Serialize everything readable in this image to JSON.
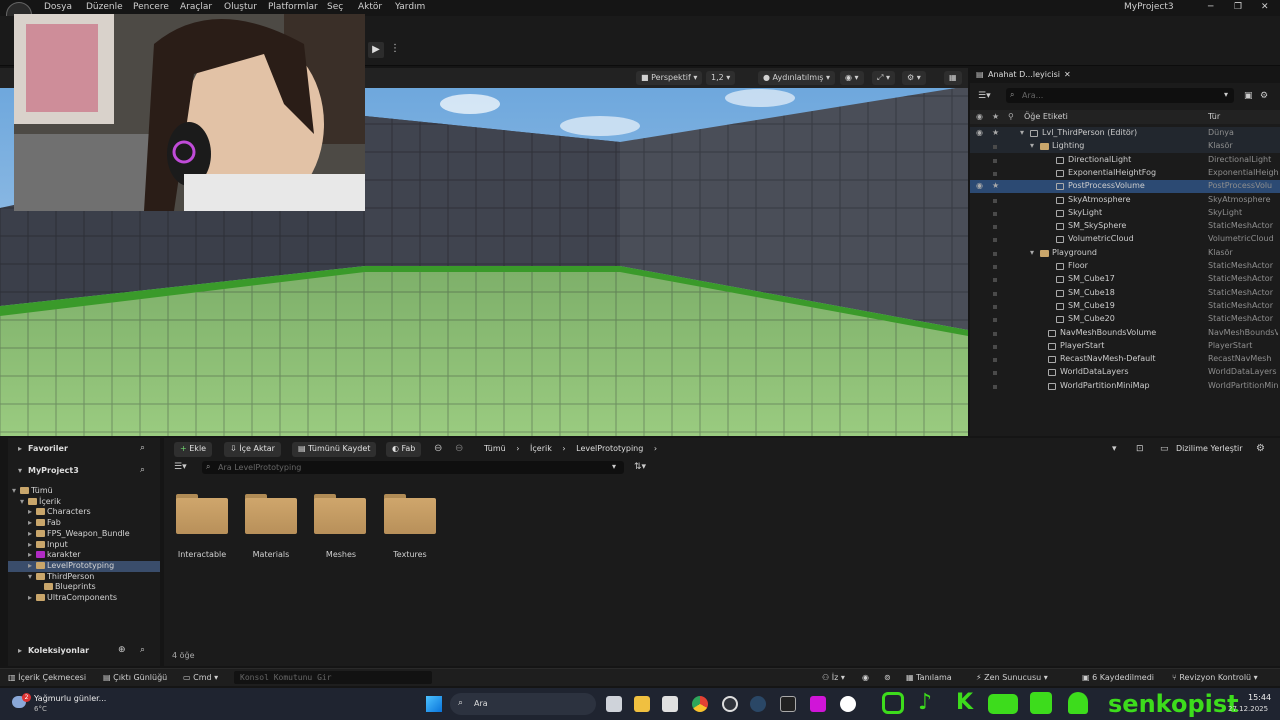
{
  "window": {
    "title": "MyProject3"
  },
  "menu": [
    "Dosya",
    "Düzenle",
    "Pencere",
    "Araçlar",
    "Oluştur",
    "Platformlar",
    "Seç",
    "Aktör",
    "Yardım"
  ],
  "viewport": {
    "buttons": {
      "perspective": "Perspektif",
      "fov": "1,2",
      "lit": "Aydınlatılmış"
    }
  },
  "outliner": {
    "tab": "Anahat D...leyicisi",
    "search_placeholder": "Ara...",
    "col_label": "Öğe Etiketi",
    "col_type": "Tür",
    "rows": [
      {
        "name": "Lvl_ThirdPerson (Editör)",
        "type": "Dünya"
      },
      {
        "name": "Lighting",
        "type": "Klasör"
      },
      {
        "name": "DirectionalLight",
        "type": "DirectionalLight"
      },
      {
        "name": "ExponentialHeightFog",
        "type": "ExponentialHeight"
      },
      {
        "name": "PostProcessVolume",
        "type": "PostProcessVolu"
      },
      {
        "name": "SkyAtmosphere",
        "type": "SkyAtmosphere"
      },
      {
        "name": "SkyLight",
        "type": "SkyLight"
      },
      {
        "name": "SM_SkySphere",
        "type": "StaticMeshActor"
      },
      {
        "name": "VolumetricCloud",
        "type": "VolumetricCloud"
      },
      {
        "name": "Playground",
        "type": "Klasör"
      },
      {
        "name": "Floor",
        "type": "StaticMeshActor"
      },
      {
        "name": "SM_Cube17",
        "type": "StaticMeshActor"
      },
      {
        "name": "SM_Cube18",
        "type": "StaticMeshActor"
      },
      {
        "name": "SM_Cube19",
        "type": "StaticMeshActor"
      },
      {
        "name": "SM_Cube20",
        "type": "StaticMeshActor"
      },
      {
        "name": "NavMeshBoundsVolume",
        "type": "NavMeshBoundsV"
      },
      {
        "name": "PlayerStart",
        "type": "PlayerStart"
      },
      {
        "name": "RecastNavMesh-Default",
        "type": "RecastNavMesh"
      },
      {
        "name": "WorldDataLayers",
        "type": "WorldDataLayers"
      },
      {
        "name": "WorldPartitionMiniMap",
        "type": "WorldPartitionMin"
      }
    ]
  },
  "content": {
    "favorites": "Favoriler",
    "project": "MyProject3",
    "tree": [
      "Tümü",
      "İçerik",
      "Characters",
      "Fab",
      "FPS_Weapon_Bundle",
      "Input",
      "karakter",
      "LevelPrototyping",
      "ThirdPerson",
      "Blueprints",
      "UltraComponents"
    ],
    "collections": "Koleksiyonlar",
    "buttons": {
      "add": "Ekle",
      "import": "İçe Aktar",
      "save_all": "Tümünü Kaydet",
      "fab": "Fab"
    },
    "breadcrumb": [
      "Tümü",
      "İçerik",
      "LevelPrototyping"
    ],
    "search_placeholder": "Ara LevelPrototyping",
    "settings_label": "Dizilime Yerleştir",
    "folders": [
      "Interactable",
      "Materials",
      "Meshes",
      "Textures"
    ],
    "count": "4 öğe"
  },
  "status": {
    "drawer": "İçerik Çekmecesi",
    "output": "Çıktı Günlüğü",
    "cmd": "Cmd",
    "console_placeholder": "Konsol Komutunu Gir",
    "trace": "İz",
    "derive": "Tanılama",
    "zen": "Zen Sunucusu",
    "saved": "6 Kaydedilmedi",
    "revision": "Revizyon Kontrolü"
  },
  "taskbar": {
    "weather": "Yağmurlu günler...",
    "temp": "6°C",
    "badge": "2",
    "search": "Ara",
    "time": "15:44",
    "date": "27.12.2025",
    "overlay_name": "senkopist"
  }
}
